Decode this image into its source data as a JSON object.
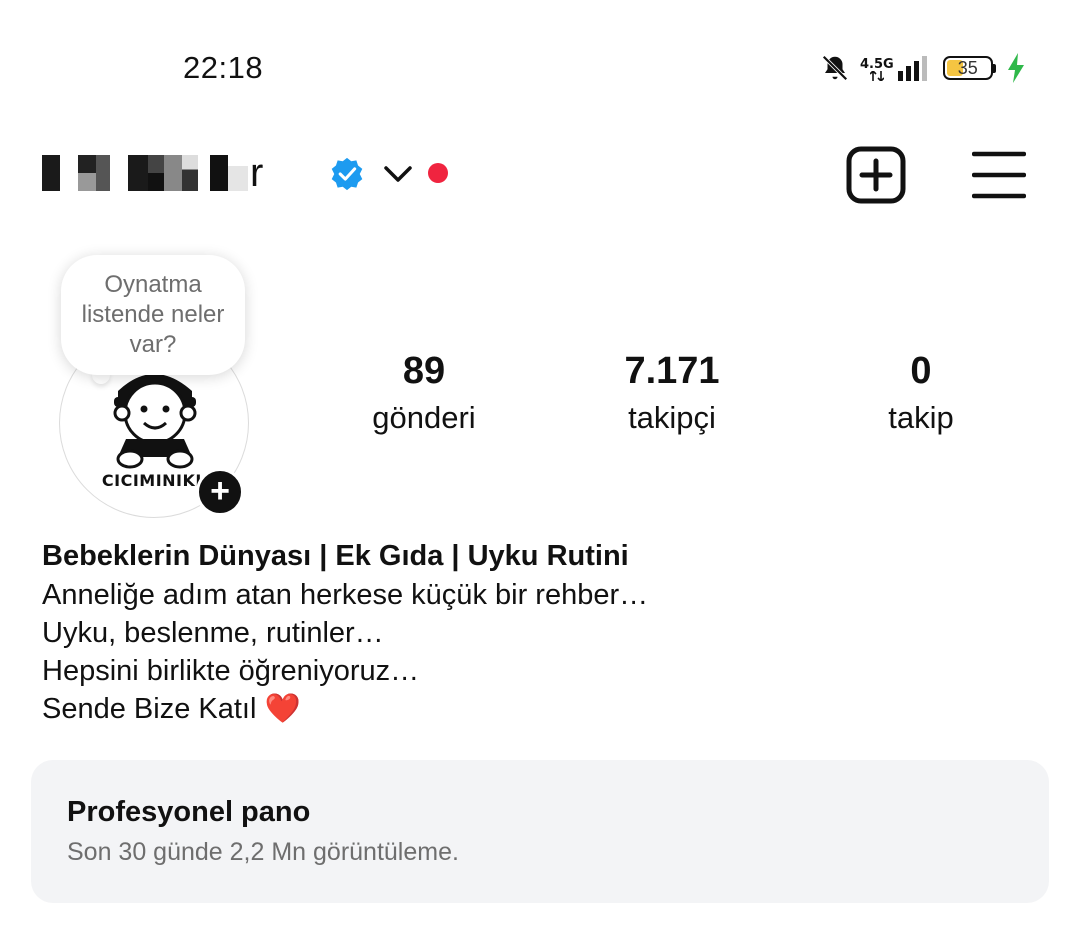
{
  "status_bar": {
    "time": "22:18",
    "network": "4.5G",
    "battery": "35",
    "icons": [
      "bell-muted-icon",
      "signal-icon",
      "battery-icon",
      "charging-bolt-icon"
    ]
  },
  "header": {
    "username_tail": "r",
    "icons": [
      "verified-badge-icon",
      "chevron-down-icon",
      "new-post-icon",
      "menu-icon"
    ],
    "colors": {
      "verified": "#1d9bf0",
      "notification_dot": "#f0243f"
    }
  },
  "profile": {
    "avatar_brand": "CICIMINIKL",
    "tooltip": "Oynatma listende neler var?",
    "stats": [
      {
        "value": "89",
        "label": "gönderi"
      },
      {
        "value": "7.171",
        "label": "takipçi"
      },
      {
        "value": "0",
        "label": "takip"
      }
    ]
  },
  "bio": {
    "name": "Bebeklerin Dünyası | Ek Gıda | Uyku Rutini",
    "lines": [
      "Anneliğe adım atan herkese küçük bir rehber…",
      "Uyku, beslenme, rutinler…",
      "Hepsini birlikte öğreniyoruz…",
      "Sende Bize Katıl ❤️"
    ]
  },
  "professional_dashboard": {
    "title": "Profesyonel pano",
    "subtitle": "Son 30 günde 2,2 Mn görüntüleme."
  }
}
